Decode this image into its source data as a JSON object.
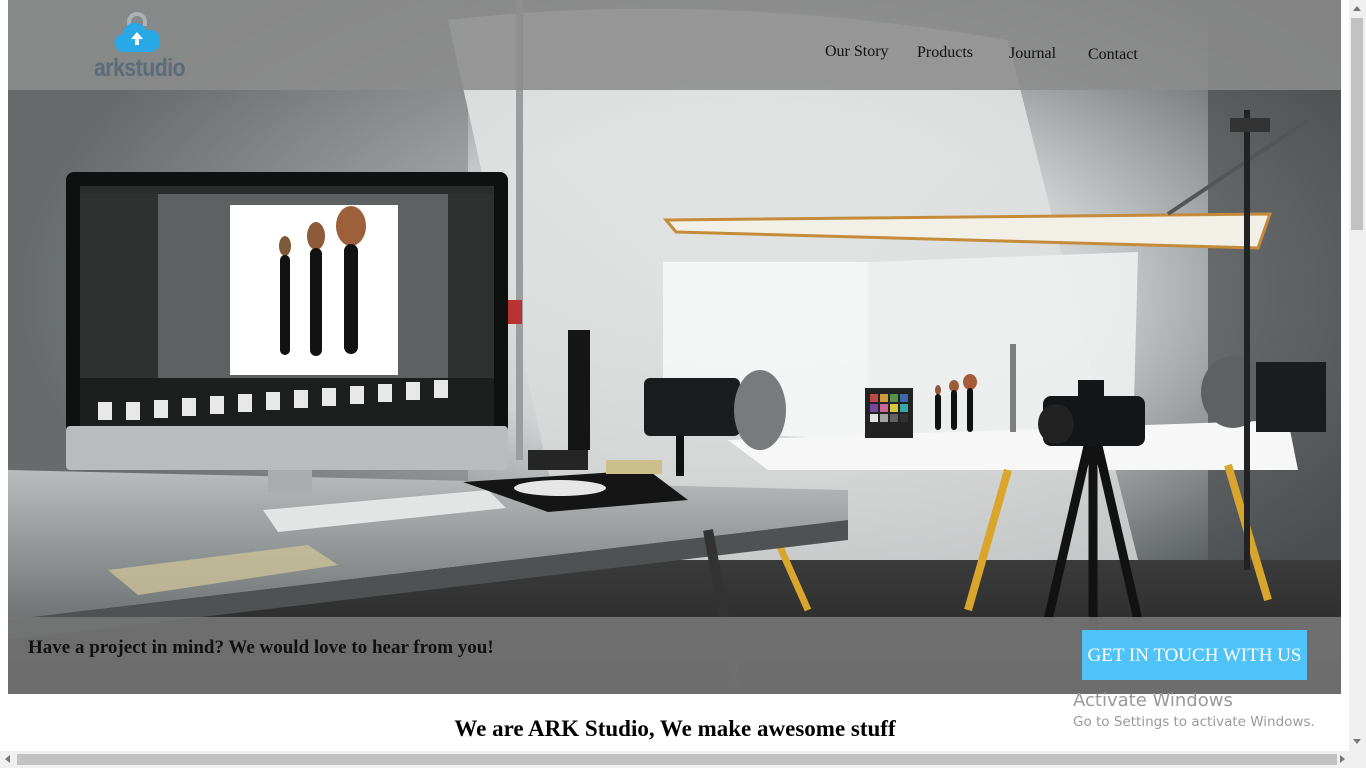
{
  "brand": {
    "logo_text": "arkstudio",
    "logo_icon": "cloud-lock-upload-icon",
    "logo_color": "#29a8e8"
  },
  "nav": {
    "items": [
      {
        "label": "Our Story"
      },
      {
        "label": "Products"
      },
      {
        "label": "Journal"
      },
      {
        "label": "Contact"
      }
    ]
  },
  "hero": {
    "image": "photo-studio-workspace-image"
  },
  "cta": {
    "text": "Have a project in mind? We would love to hear from you!",
    "button_label": "GET IN TOUCH WITH US",
    "button_color": "#4fc3f7"
  },
  "tagline": "We are ARK Studio, We make awesome stuff",
  "watermark": {
    "title": "Activate Windows",
    "subtitle": "Go to Settings to activate Windows."
  }
}
